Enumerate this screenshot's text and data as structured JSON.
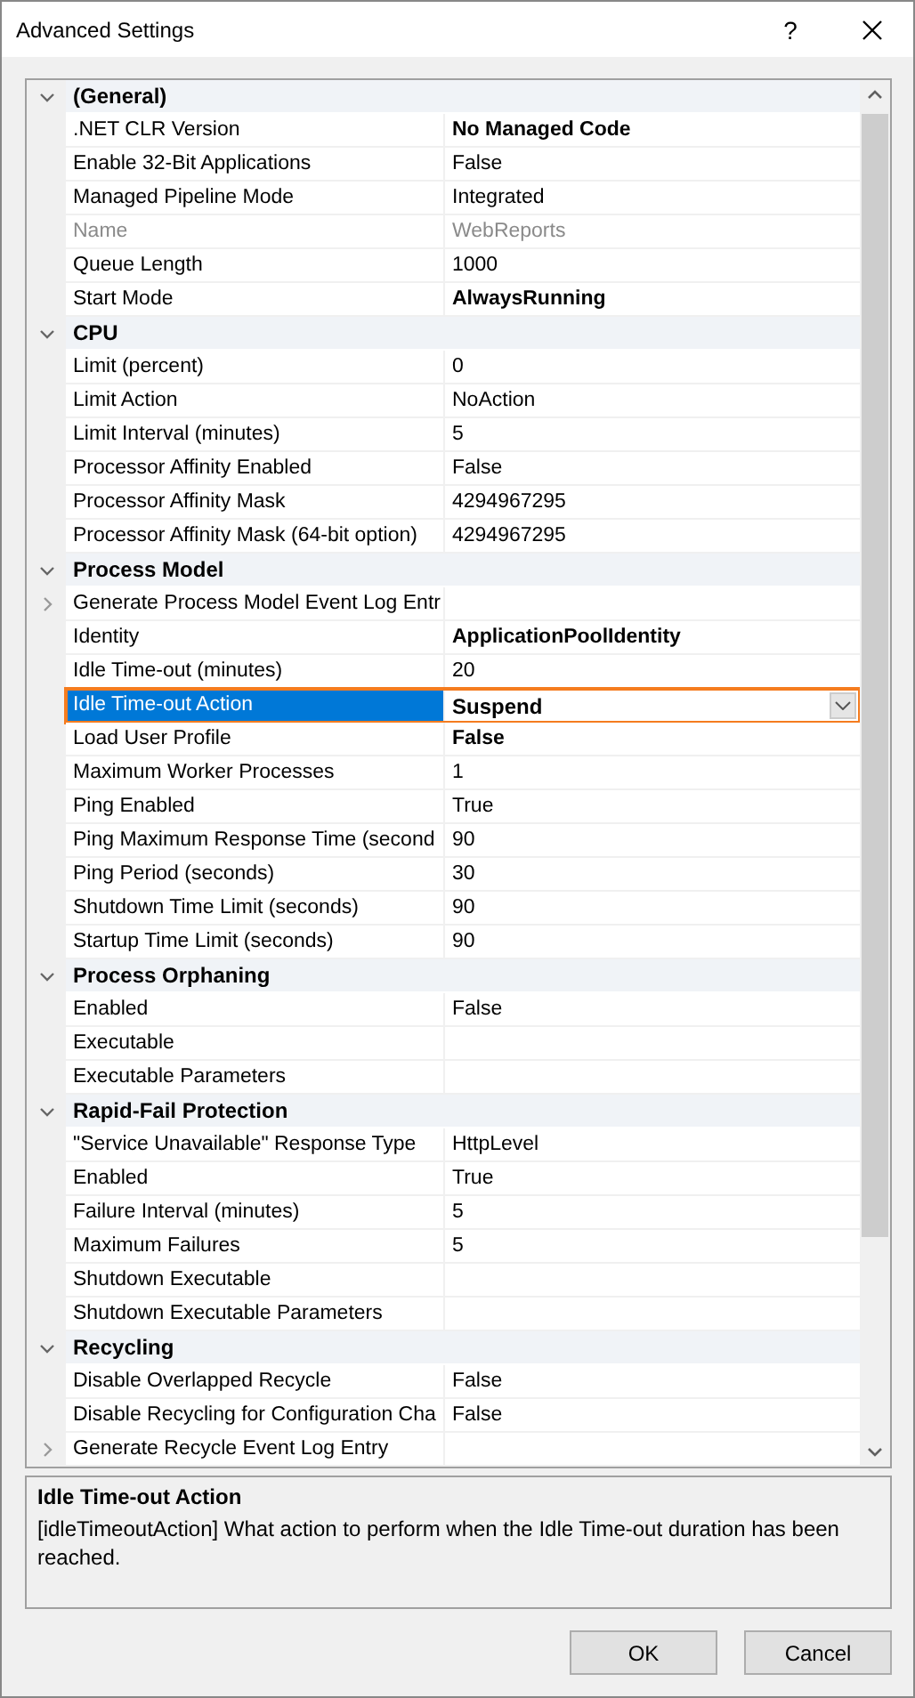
{
  "window": {
    "title": "Advanced Settings",
    "help": "?"
  },
  "categories": [
    {
      "title": "(General)",
      "expanded": true,
      "properties": [
        {
          "name": ".NET CLR Version",
          "value": "No Managed Code",
          "modified": true,
          "disabled": false,
          "selected": false
        },
        {
          "name": "Enable 32-Bit Applications",
          "value": "False",
          "modified": false,
          "disabled": false,
          "selected": false
        },
        {
          "name": "Managed Pipeline Mode",
          "value": "Integrated",
          "modified": false,
          "disabled": false,
          "selected": false
        },
        {
          "name": "Name",
          "value": "WebReports",
          "modified": false,
          "disabled": true,
          "selected": false
        },
        {
          "name": "Queue Length",
          "value": "1000",
          "modified": false,
          "disabled": false,
          "selected": false
        },
        {
          "name": "Start Mode",
          "value": "AlwaysRunning",
          "modified": true,
          "disabled": false,
          "selected": false
        }
      ]
    },
    {
      "title": "CPU",
      "expanded": true,
      "properties": [
        {
          "name": "Limit (percent)",
          "value": "0",
          "modified": false,
          "disabled": false,
          "selected": false
        },
        {
          "name": "Limit Action",
          "value": "NoAction",
          "modified": false,
          "disabled": false,
          "selected": false
        },
        {
          "name": "Limit Interval (minutes)",
          "value": "5",
          "modified": false,
          "disabled": false,
          "selected": false
        },
        {
          "name": "Processor Affinity Enabled",
          "value": "False",
          "modified": false,
          "disabled": false,
          "selected": false
        },
        {
          "name": "Processor Affinity Mask",
          "value": "4294967295",
          "modified": false,
          "disabled": false,
          "selected": false
        },
        {
          "name": "Processor Affinity Mask (64-bit option)",
          "value": "4294967295",
          "modified": false,
          "disabled": false,
          "selected": false
        }
      ]
    },
    {
      "title": "Process Model",
      "expanded": true,
      "properties": [
        {
          "name": "Generate Process Model Event Log Entr",
          "expanded": false,
          "disabled": false,
          "selected": false
        },
        {
          "name": "Identity",
          "value": "ApplicationPoolIdentity",
          "modified": true,
          "disabled": false,
          "selected": false
        },
        {
          "name": "Idle Time-out (minutes)",
          "value": "20",
          "modified": false,
          "disabled": false,
          "selected": false
        },
        {
          "name": "Idle Time-out Action",
          "value": "Suspend",
          "modified": true,
          "disabled": false,
          "selected": true
        },
        {
          "name": "Load User Profile",
          "value": "False",
          "modified": true,
          "disabled": false,
          "selected": false
        },
        {
          "name": "Maximum Worker Processes",
          "value": "1",
          "modified": false,
          "disabled": false,
          "selected": false
        },
        {
          "name": "Ping Enabled",
          "value": "True",
          "modified": false,
          "disabled": false,
          "selected": false
        },
        {
          "name": "Ping Maximum Response Time (second",
          "value": "90",
          "modified": false,
          "disabled": false,
          "selected": false
        },
        {
          "name": "Ping Period (seconds)",
          "value": "30",
          "modified": false,
          "disabled": false,
          "selected": false
        },
        {
          "name": "Shutdown Time Limit (seconds)",
          "value": "90",
          "modified": false,
          "disabled": false,
          "selected": false
        },
        {
          "name": "Startup Time Limit (seconds)",
          "value": "90",
          "modified": false,
          "disabled": false,
          "selected": false
        }
      ]
    },
    {
      "title": "Process Orphaning",
      "expanded": true,
      "properties": [
        {
          "name": "Enabled",
          "value": "False",
          "modified": false,
          "disabled": false,
          "selected": false
        },
        {
          "name": "Executable",
          "disabled": false,
          "selected": false
        },
        {
          "name": "Executable Parameters",
          "disabled": false,
          "selected": false
        }
      ]
    },
    {
      "title": "Rapid-Fail Protection",
      "expanded": true,
      "properties": [
        {
          "name": "\"Service Unavailable\" Response Type",
          "value": "HttpLevel",
          "modified": false,
          "disabled": false,
          "selected": false
        },
        {
          "name": "Enabled",
          "value": "True",
          "modified": false,
          "disabled": false,
          "selected": false
        },
        {
          "name": "Failure Interval (minutes)",
          "value": "5",
          "modified": false,
          "disabled": false,
          "selected": false
        },
        {
          "name": "Maximum Failures",
          "value": "5",
          "modified": false,
          "disabled": false,
          "selected": false
        },
        {
          "name": "Shutdown Executable",
          "disabled": false,
          "selected": false
        },
        {
          "name": "Shutdown Executable Parameters",
          "disabled": false,
          "selected": false
        }
      ]
    },
    {
      "title": "Recycling",
      "expanded": true,
      "properties": [
        {
          "name": "Disable Overlapped Recycle",
          "value": "False",
          "modified": false,
          "disabled": false,
          "selected": false
        },
        {
          "name": "Disable Recycling for Configuration Cha",
          "value": "False",
          "modified": false,
          "disabled": false,
          "selected": false
        },
        {
          "name": "Generate Recycle Event Log Entry",
          "expanded": false,
          "disabled": false,
          "selected": false
        }
      ]
    }
  ],
  "description": {
    "title": "Idle Time-out Action",
    "text": "[idleTimeoutAction] What action to perform when the Idle Time-out duration has been reached."
  },
  "buttons": [
    "OK",
    "Cancel"
  ]
}
